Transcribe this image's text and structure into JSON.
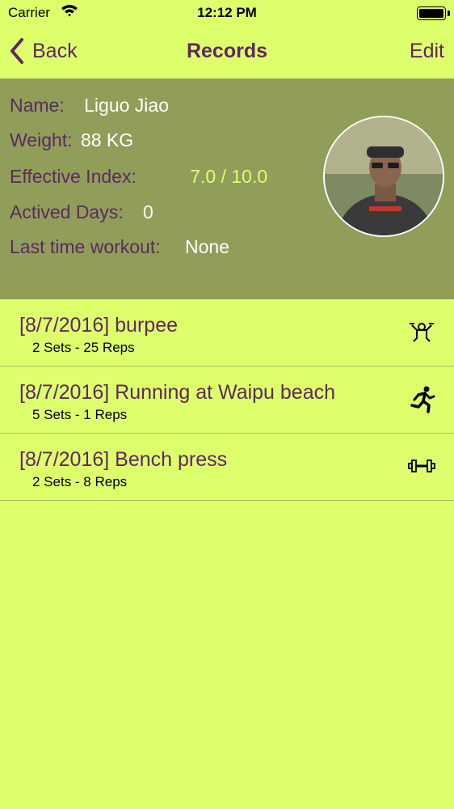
{
  "status": {
    "carrier": "Carrier",
    "time": "12:12 PM"
  },
  "nav": {
    "back_label": "Back",
    "title": "Records",
    "edit_label": "Edit"
  },
  "profile": {
    "name_label": "Name:",
    "name_value": "Liguo Jiao",
    "weight_label": "Weight:",
    "weight_value": "88 KG",
    "index_label": "Effective Index:",
    "index_value": "7.0 / 10.0",
    "days_label": "Actived Days:",
    "days_value": "0",
    "last_label": "Last time workout:",
    "last_value": "None"
  },
  "records": [
    {
      "title": "[8/7/2016] burpee",
      "detail": "2 Sets - 25 Reps",
      "icon": "burpee-icon"
    },
    {
      "title": "[8/7/2016] Running at Waipu beach",
      "detail": "5 Sets - 1 Reps",
      "icon": "running-icon"
    },
    {
      "title": "[8/7/2016] Bench press",
      "detail": "2 Sets - 8 Reps",
      "icon": "dumbbell-icon"
    }
  ],
  "colors": {
    "background": "#deff6c",
    "header_panel": "#909e5a",
    "accent_text": "#5b2a5e"
  }
}
